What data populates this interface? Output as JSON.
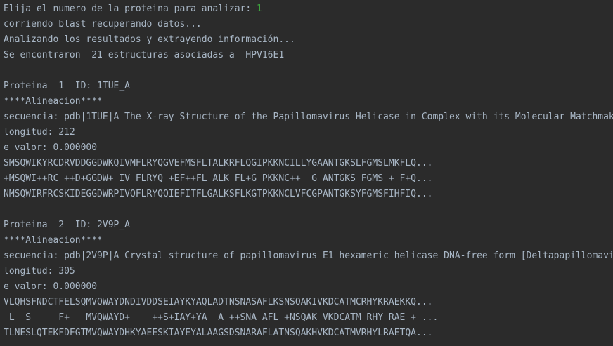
{
  "console": {
    "prompt": "Elija el numero de la proteina para analizar: ",
    "input_value": "1",
    "status_blast": "corriendo blast recuperando datos...",
    "status_analyzing": "Analizando los resultados y extrayendo información...",
    "summary": "Se encontraron  21 estructuras asociadas a  HPV16E1",
    "results": [
      {
        "header": "Proteina  1  ID: 1TUE_A",
        "alignment_title": "****Alineacion****",
        "sequence": "secuencia: pdb|1TUE|A The X-ray Structure of the Papillomavirus Helicase in Complex with its Molecular Matchmaker",
        "length": "longitud: 212",
        "evalue": "e valor: 0.000000",
        "query": "SMSQWIKYRCDRVDDGGDWKQIVMFLRYQGVEFMSFLTALKRFLQGIPKKNCILLYGAANTGKSLFGMSLMKFLQ...",
        "match": "+MSQWI++RC ++D+GGDW+ IV FLRYQ +EF++FL ALK FL+G PKKNC++  G ANTGKS FGMS + F+Q...",
        "subject": "NMSQWIRFRCSKIDEGGDWRPIVQFLRYQQIEFITFLGALKSFLKGTPKKNCLVFCGPANTGKSYFGMSFIHFIQ..."
      },
      {
        "header": "Proteina  2  ID: 2V9P_A",
        "alignment_title": "****Alineacion****",
        "sequence": "secuencia: pdb|2V9P|A Crystal structure of papillomavirus E1 hexameric helicase DNA-free form [Deltapapillomavirus",
        "length": "longitud: 305",
        "evalue": "e valor: 0.000000",
        "query": "VLQHSFNDCTFELSQMVQWAYDNDIVDDSEIAYKYAQLADTNSNASAFLKSNSQAKIVKDCATMCRHYKRAEKKQ...",
        "match": " L  S     F+   MVQWAYD+    ++S+IAY+YA  A ++SNA AFL +NSQAK VKDCATM RHY RAE + ...",
        "subject": "TLNESLQTEKFDFGTMVQWAYDHKYAEESKIAYEYALAAGSDSNARAFLATNSQAKHVKDCATMVRHYLRAETQA..."
      }
    ]
  }
}
